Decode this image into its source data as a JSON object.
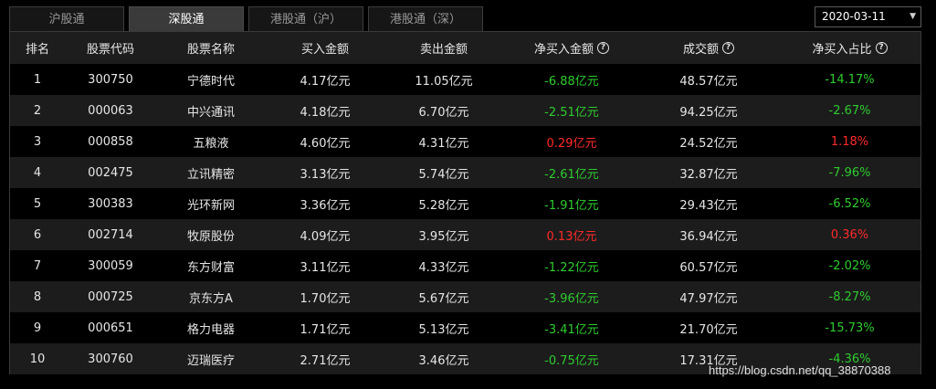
{
  "tabs": [
    {
      "label": "沪股通",
      "active": false
    },
    {
      "label": "深股通",
      "active": true
    },
    {
      "label": "港股通（沪）",
      "active": false
    },
    {
      "label": "港股通（深）",
      "active": false
    }
  ],
  "date_select": {
    "value": "2020-03-11",
    "caret": "▼"
  },
  "columns": [
    "排名",
    "股票代码",
    "股票名称",
    "买入金额",
    "卖出金额",
    "净买入金额",
    "成交额",
    "净买入占比"
  ],
  "help_icon": "?",
  "rows": [
    {
      "rank": "1",
      "code": "300750",
      "name": "宁德时代",
      "buy": "4.17亿元",
      "sell": "11.05亿元",
      "net": "-6.88亿元",
      "turnover": "48.57亿元",
      "ratio": "-14.17%",
      "dir": "neg"
    },
    {
      "rank": "2",
      "code": "000063",
      "name": "中兴通讯",
      "buy": "4.18亿元",
      "sell": "6.70亿元",
      "net": "-2.51亿元",
      "turnover": "94.25亿元",
      "ratio": "-2.67%",
      "dir": "neg"
    },
    {
      "rank": "3",
      "code": "000858",
      "name": "五粮液",
      "buy": "4.60亿元",
      "sell": "4.31亿元",
      "net": "0.29亿元",
      "turnover": "24.52亿元",
      "ratio": "1.18%",
      "dir": "pos"
    },
    {
      "rank": "4",
      "code": "002475",
      "name": "立讯精密",
      "buy": "3.13亿元",
      "sell": "5.74亿元",
      "net": "-2.61亿元",
      "turnover": "32.87亿元",
      "ratio": "-7.96%",
      "dir": "neg"
    },
    {
      "rank": "5",
      "code": "300383",
      "name": "光环新网",
      "buy": "3.36亿元",
      "sell": "5.28亿元",
      "net": "-1.91亿元",
      "turnover": "29.43亿元",
      "ratio": "-6.52%",
      "dir": "neg"
    },
    {
      "rank": "6",
      "code": "002714",
      "name": "牧原股份",
      "buy": "4.09亿元",
      "sell": "3.95亿元",
      "net": "0.13亿元",
      "turnover": "36.94亿元",
      "ratio": "0.36%",
      "dir": "pos"
    },
    {
      "rank": "7",
      "code": "300059",
      "name": "东方财富",
      "buy": "3.11亿元",
      "sell": "4.33亿元",
      "net": "-1.22亿元",
      "turnover": "60.57亿元",
      "ratio": "-2.02%",
      "dir": "neg"
    },
    {
      "rank": "8",
      "code": "000725",
      "name": "京东方A",
      "buy": "1.70亿元",
      "sell": "5.67亿元",
      "net": "-3.96亿元",
      "turnover": "47.97亿元",
      "ratio": "-8.27%",
      "dir": "neg"
    },
    {
      "rank": "9",
      "code": "000651",
      "name": "格力电器",
      "buy": "1.71亿元",
      "sell": "5.13亿元",
      "net": "-3.41亿元",
      "turnover": "21.70亿元",
      "ratio": "-15.73%",
      "dir": "neg"
    },
    {
      "rank": "10",
      "code": "300760",
      "name": "迈瑞医疗",
      "buy": "2.71亿元",
      "sell": "3.46亿元",
      "net": "-0.75亿元",
      "turnover": "17.31亿元",
      "ratio": "-4.36%",
      "dir": "neg"
    }
  ],
  "colors": {
    "negative": "#2ecc2e",
    "positive": "#ff2a2a",
    "active_tab": "#3a3a3a"
  },
  "watermark": "https://blog.csdn.net/qq_38870388"
}
